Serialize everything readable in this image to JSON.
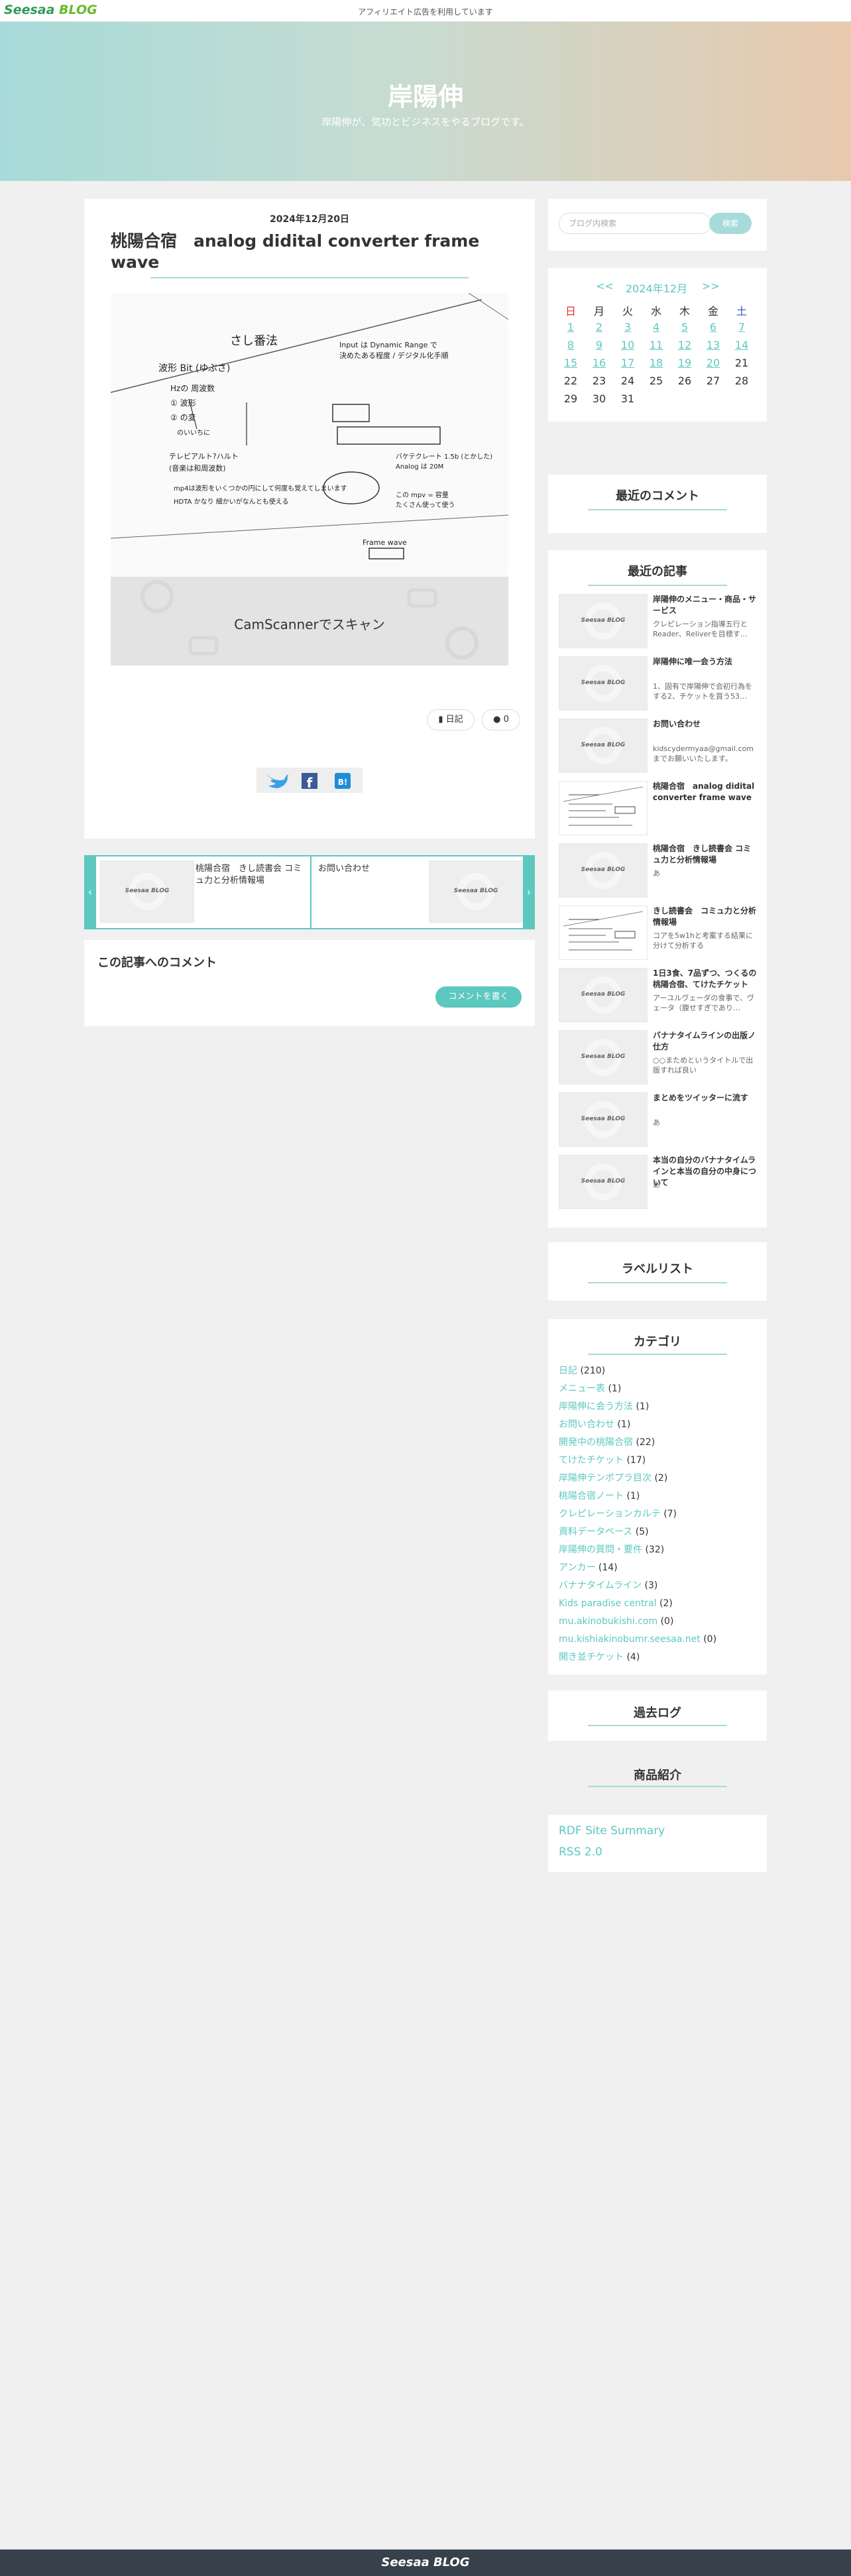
{
  "header": {
    "logo_main": "Seesaa",
    "logo_sub": "BLOG",
    "notice": "アフィリエイト広告を利用しています"
  },
  "hero": {
    "title": "岸陽伸",
    "description": "岸陽伸が、気功とビジネスをやるブログです。"
  },
  "post": {
    "date": "2024年12月20日",
    "title": "桃陽合宿　analog didital converter frame wave",
    "image_caption": "CamScannerでスキャン",
    "scan_heading": "さし番法",
    "scan_lines": [
      "Input は Dynamic Range で",
      "決めたある程度 / デジタル化手順",
      "波形 Bit (ゆぶさ)",
      "Hzの 周波数",
      "① 波形",
      "② の変",
      "のいいちに",
      "テレビアルト?ハルト",
      "(音楽は和周波数)",
      "mp4は波形をいくつかの円にして何度も覚えてしまいます",
      "HDTA かなり 細かいがなんとも使える",
      "バケテクレート 1.5b (とかした)",
      "Analog は 20M",
      "この mpv = 容量",
      "たくさん使って使う",
      "Frame wave"
    ],
    "tag_label": "日記",
    "comment_count": "0",
    "share_icons": [
      "twitter-icon",
      "facebook-icon",
      "hatena-bookmark-icon"
    ]
  },
  "post_nav": {
    "prev_arrow": "‹",
    "next_arrow": "›",
    "prev_title": "桃陽合宿　きし読書会 コミュ力と分析情報場",
    "next_title": "お問い合わせ",
    "thumb_label": "Seesaa BLOG"
  },
  "comments": {
    "heading": "この記事へのコメント",
    "button": "コメントを書く"
  },
  "sidebar": {
    "search": {
      "placeholder": "ブログ内検索",
      "button": "検索"
    },
    "calendar": {
      "prev": "<<",
      "month": "2024年12月",
      "next": ">>",
      "weekdays": [
        "日",
        "月",
        "火",
        "水",
        "木",
        "金",
        "土"
      ],
      "weeks": [
        [
          {
            "d": "1",
            "link": true
          },
          {
            "d": "2",
            "link": true
          },
          {
            "d": "3",
            "link": true
          },
          {
            "d": "4",
            "link": true
          },
          {
            "d": "5",
            "link": true
          },
          {
            "d": "6",
            "link": true
          },
          {
            "d": "7",
            "link": true
          }
        ],
        [
          {
            "d": "8",
            "link": true
          },
          {
            "d": "9",
            "link": true
          },
          {
            "d": "10",
            "link": true
          },
          {
            "d": "11",
            "link": true
          },
          {
            "d": "12",
            "link": true
          },
          {
            "d": "13",
            "link": true
          },
          {
            "d": "14",
            "link": true
          }
        ],
        [
          {
            "d": "15",
            "link": true
          },
          {
            "d": "16",
            "link": true
          },
          {
            "d": "17",
            "link": true
          },
          {
            "d": "18",
            "link": true
          },
          {
            "d": "19",
            "link": true
          },
          {
            "d": "20",
            "link": true
          },
          {
            "d": "21",
            "link": false
          }
        ],
        [
          {
            "d": "22",
            "link": false
          },
          {
            "d": "23",
            "link": false
          },
          {
            "d": "24",
            "link": false
          },
          {
            "d": "25",
            "link": false
          },
          {
            "d": "26",
            "link": false
          },
          {
            "d": "27",
            "link": false
          },
          {
            "d": "28",
            "link": false
          }
        ],
        [
          {
            "d": "29",
            "link": false
          },
          {
            "d": "30",
            "link": false
          },
          {
            "d": "31",
            "link": false
          }
        ]
      ],
      "colors": {
        "sunday": "#e03030",
        "saturday": "#3050c0",
        "link": "#5cc8c0"
      }
    },
    "recent_comments_title": "最近のコメント",
    "recent_posts_title": "最近の記事",
    "recent_posts": [
      {
        "title": "岸陽伸のメニュー・商品・サービス",
        "excerpt": "クレピレーション指導五行とReader、Reliverを目標す…",
        "thumb": "logo"
      },
      {
        "title": "岸陽伸に唯一会う方法",
        "excerpt": "1、固有で岸陽伸で会初行為をする2、チケットを買う53…",
        "thumb": "logo"
      },
      {
        "title": "お問い合わせ",
        "excerpt": "kidscydermyaa@gmail.comまでお願いいたします。",
        "thumb": "logo"
      },
      {
        "title": "桃陽合宿　analog didital converter frame wave",
        "excerpt": "",
        "thumb": "scan"
      },
      {
        "title": "桃陽合宿　きし読書会 コミュ力と分析情報場",
        "excerpt": "あ",
        "thumb": "logo"
      },
      {
        "title": "きし読書会　コミュ力と分析情報場",
        "excerpt": "コアを5w1hと考案する結果に分けて分析する",
        "thumb": "scan"
      },
      {
        "title": "1日3食、7品ずつ、つくるの桃陽合宿、てけたチケット",
        "excerpt": "アーユルヴェーダの食事で、ヴェータ（腹せすぎであり…",
        "thumb": "logo"
      },
      {
        "title": "バナナタイムラインの出版ノ仕方",
        "excerpt": "○○まためというタイトルで出版すれば良い",
        "thumb": "logo"
      },
      {
        "title": "まとめをツイッターに流す",
        "excerpt": "あ",
        "thumb": "logo"
      },
      {
        "title": "本当の自分のバナナタイムラインと本当の自分の中身について",
        "excerpt": "あ",
        "thumb": "logo"
      }
    ],
    "labels_title": "ラベルリスト",
    "categories_title": "カテゴリ",
    "categories": [
      {
        "name": "日記",
        "count": "(210)"
      },
      {
        "name": "メニュー表",
        "count": "(1)"
      },
      {
        "name": "岸陽伸に会う方法",
        "count": "(1)"
      },
      {
        "name": "お問い合わせ",
        "count": "(1)"
      },
      {
        "name": "開発中の桃陽合宿",
        "count": "(22)"
      },
      {
        "name": "てけたチケット",
        "count": "(17)"
      },
      {
        "name": "岸陽伸テンポプラ目次",
        "count": "(2)"
      },
      {
        "name": "桃陽合宿ノート",
        "count": "(1)"
      },
      {
        "name": "クレピレーションカルテ",
        "count": "(7)"
      },
      {
        "name": "資料データベース",
        "count": "(5)"
      },
      {
        "name": "岸陽伸の質問・要件",
        "count": "(32)"
      },
      {
        "name": "アンカー",
        "count": "(14)"
      },
      {
        "name": "バナナタイムライン",
        "count": "(3)"
      },
      {
        "name": "Kids paradise central",
        "count": "(2)"
      },
      {
        "name": "mu.akinobukishi.com",
        "count": "(0)"
      },
      {
        "name": "mu.kishiakinobumr.seesaa.net",
        "count": "(0)"
      },
      {
        "name": "開き並チケット",
        "count": "(4)"
      }
    ],
    "archive_title": "過去ログ",
    "products_title": "商品紹介",
    "feeds": [
      "RDF Site Summary",
      "RSS 2.0"
    ]
  },
  "footer": {
    "logo": "Seesaa BLOG"
  }
}
